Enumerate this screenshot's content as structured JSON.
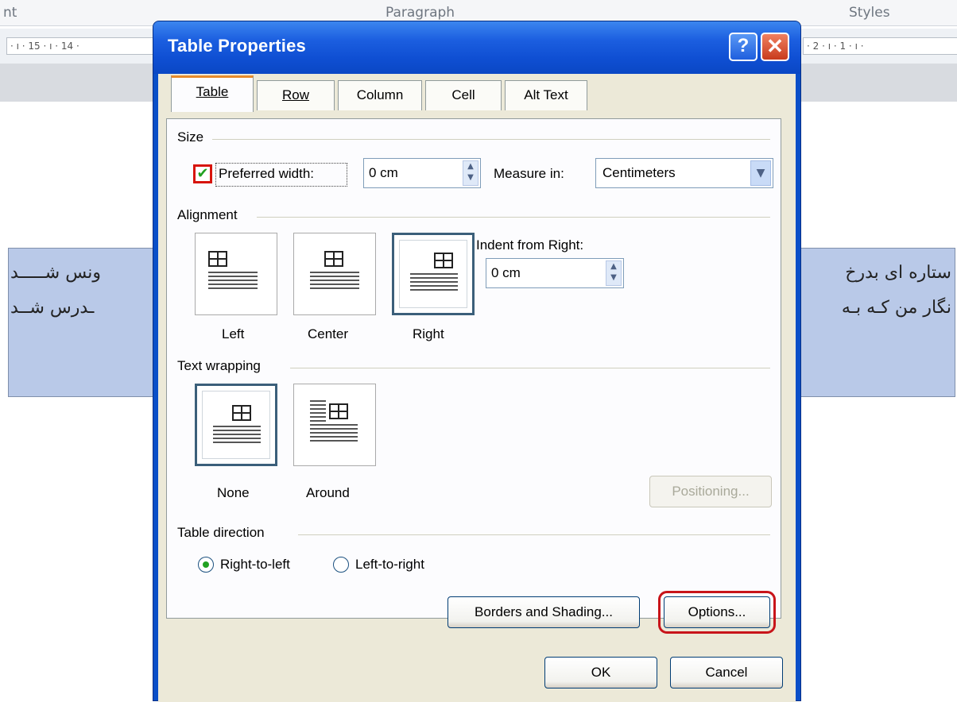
{
  "background": {
    "ribbon_labels": [
      "nt",
      "Paragraph",
      "Styles"
    ],
    "ruler_left": "· ı · 15 · ı · 14 ·",
    "ruler_right": "· 2 · ı · 1 · ı ·",
    "doc_lines": [
      {
        "right": "ستاره ای بدرخ",
        "left": "ونس شـــــد"
      },
      {
        "right": "نگار من کـه بـه",
        "left": "ـدرس شــد"
      }
    ]
  },
  "dialog": {
    "title": "Table Properties",
    "help_glyph": "?",
    "close_glyph": "✕",
    "tabs": [
      "Table",
      "Row",
      "Column",
      "Cell",
      "Alt Text"
    ],
    "active_tab": "Table",
    "size": {
      "group_label": "Size",
      "preferred_width_label": "Preferred width:",
      "preferred_width_checked": true,
      "preferred_width_value": "0 cm",
      "measure_in_label": "Measure in:",
      "measure_in_value": "Centimeters"
    },
    "alignment": {
      "group_label": "Alignment",
      "options": [
        "Left",
        "Center",
        "Right"
      ],
      "selected": "Right",
      "indent_label": "Indent from Right:",
      "indent_value": "0 cm"
    },
    "text_wrapping": {
      "group_label": "Text wrapping",
      "options": [
        "None",
        "Around"
      ],
      "selected": "None",
      "positioning_label": "Positioning..."
    },
    "table_direction": {
      "group_label": "Table direction",
      "options": [
        "Right-to-left",
        "Left-to-right"
      ],
      "selected": "Right-to-left"
    },
    "buttons": {
      "borders_shading": "Borders and Shading...",
      "options": "Options...",
      "ok": "OK",
      "cancel": "Cancel"
    },
    "colors": {
      "titlebar": "#0f4fd3",
      "tab_highlight": "#e68b2c",
      "highlight_box": "#c8141a",
      "radio_dot": "#21a121"
    }
  }
}
